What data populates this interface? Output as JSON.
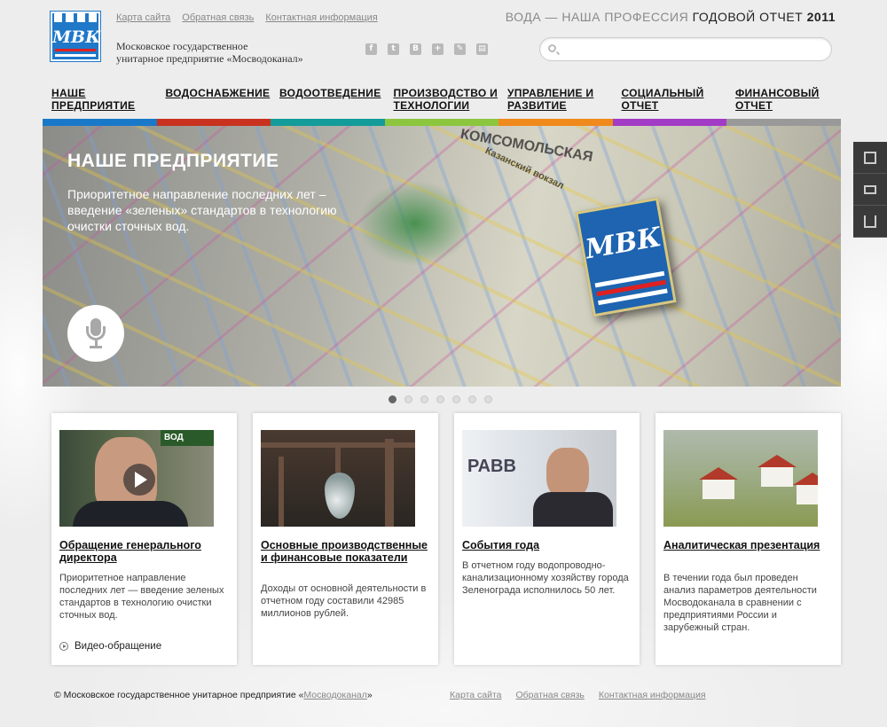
{
  "header": {
    "logo_text": "МВК",
    "top_links": [
      "Карта сайта",
      "Обратная связь",
      "Контактная информация"
    ],
    "org_name_line1": "Московское государственное",
    "org_name_line2": "унитарное предприятие «Мосводоканал»",
    "social_icons": [
      "facebook-icon",
      "twitter-icon",
      "vkontakte-icon",
      "share-icon",
      "livejournal-icon",
      "print-icon"
    ],
    "headline_part1": "ВОДА — НАША ПРОФЕССИЯ ",
    "headline_part2": "ГОДОВОЙ ОТЧЕТ ",
    "headline_year": "2011",
    "search_placeholder": ""
  },
  "nav": [
    {
      "label": "НАШЕ ПРЕДПРИЯТИЕ",
      "color": "#1a78c8"
    },
    {
      "label": "ВОДОСНАБЖЕНИЕ",
      "color": "#c8321e"
    },
    {
      "label": "ВОДООТВЕДЕНИЕ",
      "color": "#139c99"
    },
    {
      "label": "ПРОИЗВОДСТВО И ТЕХНОЛОГИИ",
      "color": "#8cc63f"
    },
    {
      "label": "УПРАВЛЕНИЕ И РАЗВИТИЕ",
      "color": "#f08a1c"
    },
    {
      "label": "СОЦИАЛЬНЫЙ ОТЧЕТ",
      "color": "#a23bc6"
    },
    {
      "label": "ФИНАНСОВЫЙ ОТЧЕТ",
      "color": "#999999"
    }
  ],
  "hero": {
    "title": "НАШЕ ПРЕДПРИЯТИЕ",
    "text": "Приоритетное направление последних лет – введение «зеленых» стандартов в технологию очистки сточных вод.",
    "badge_text": "МВК",
    "map_label_1": "КОМСОМОЛЬСКАЯ",
    "map_label_2": "Казанский вокзал",
    "slides_count": 7,
    "active_slide": 1
  },
  "tools": [
    "notepad-icon",
    "mail-icon",
    "download-icon"
  ],
  "cards": [
    {
      "title": "Обращение генерального директора",
      "desc": "Приоритетное направление последних лет — введение зеленых стандартов в технологию очистки сточных вод.",
      "video_label": "Видео-обращение",
      "photo_sign": "ВОД"
    },
    {
      "title": "Основные производственные и финансовые показатели",
      "desc": "Доходы от основной деятельности в отчетном году составили 42985 миллионов рублей."
    },
    {
      "title": "События года",
      "desc": "В отчетном году водопроводно-канализационному хозяйству города Зеленограда исполнилось 50 лет.",
      "photo_logo": "РАВВ"
    },
    {
      "title": "Аналитическая презентация",
      "desc": "В течении года был проведен анализ параметров деятельности Мосводоканала в сравнении с предприятиями России и зарубежный стран."
    }
  ],
  "footer": {
    "copy_prefix": "© Московское государственное унитарное предприятие «",
    "copy_link": "Мосводоканал",
    "copy_suffix": "»",
    "links": [
      "Карта сайта",
      "Обратная связь",
      "Контактная информация"
    ]
  }
}
